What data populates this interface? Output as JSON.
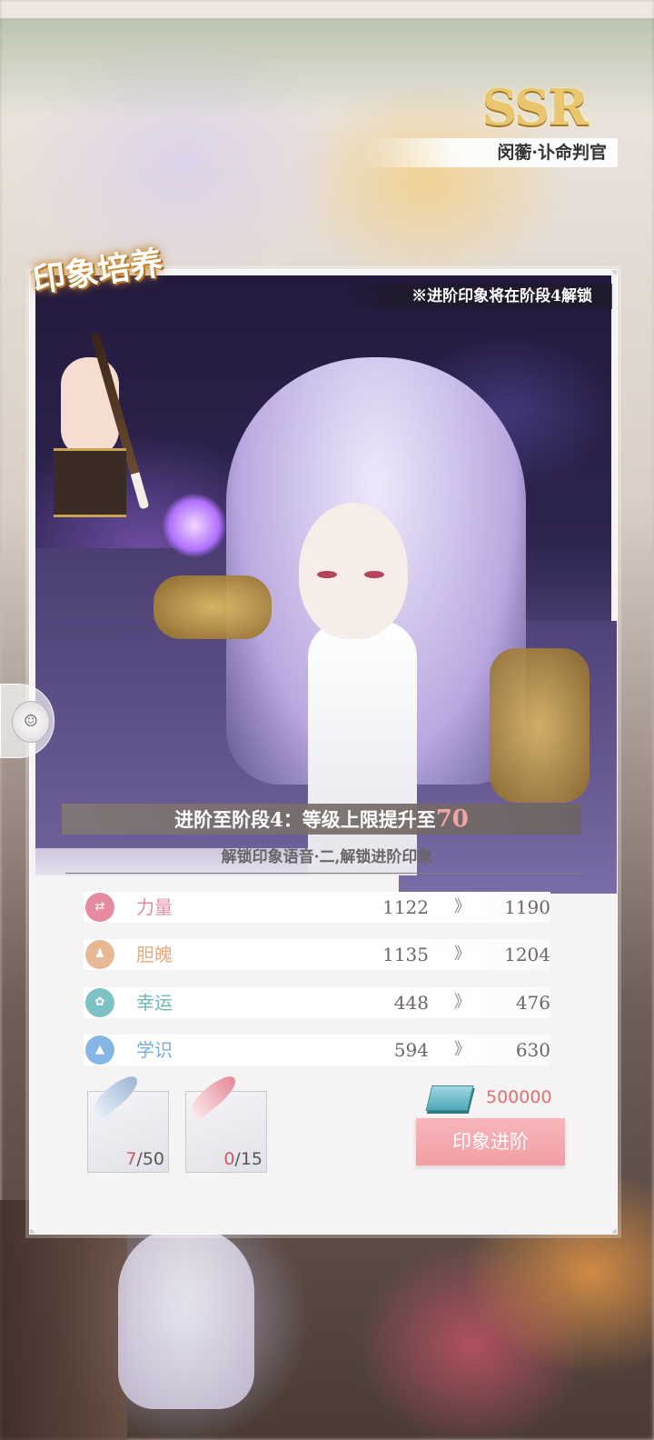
{
  "header": {
    "rarity": "SSR",
    "character_name": "闵蘅·讣命判官"
  },
  "panel": {
    "title": "印象培养",
    "notice": "※进阶印象将在阶段4解锁",
    "stage_text": "进阶至阶段4：等级上限提升至",
    "stage_level": "70",
    "unlock_text": "解锁印象语音·二,解锁进阶印象"
  },
  "stats": [
    {
      "name": "力量",
      "icon": "strength-icon",
      "color": "#e58ba0",
      "from": "1122",
      "to": "1190"
    },
    {
      "name": "胆魄",
      "icon": "courage-icon",
      "color": "#e8b894",
      "from": "1135",
      "to": "1204"
    },
    {
      "name": "幸运",
      "icon": "luck-icon",
      "color": "#7ec2c6",
      "from": "448",
      "to": "476"
    },
    {
      "name": "学识",
      "icon": "knowledge-icon",
      "color": "#86b7e4",
      "from": "594",
      "to": "630"
    }
  ],
  "stat_arrow": "》",
  "materials": [
    {
      "icon": "blue-feather-icon",
      "current": "7",
      "required": "/50"
    },
    {
      "icon": "pink-feather-icon",
      "current": "0",
      "required": "/15"
    }
  ],
  "cost": {
    "icon": "money-stack-icon",
    "amount": "500000"
  },
  "advance_button": "印象进阶",
  "colors": {
    "accent_pink": "#f19ea5",
    "cost_red": "#e2716d",
    "gold": "#e9c66f"
  }
}
